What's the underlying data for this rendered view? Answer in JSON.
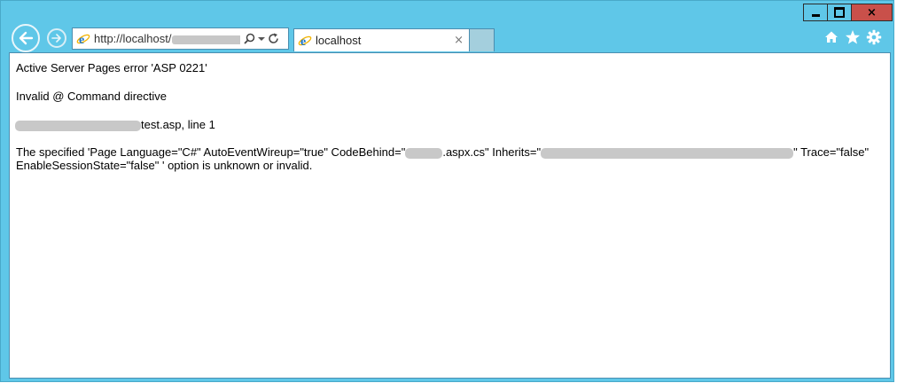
{
  "browser": {
    "address_prefix": "http://localhost/",
    "tab_title": "localhost",
    "tab_close": "×",
    "caption": {
      "minimize": "minimize",
      "maximize": "maximize",
      "close": "×"
    }
  },
  "icons": {
    "back": "back-arrow-icon",
    "forward": "forward-arrow-icon",
    "search": "search-icon",
    "dropdown": "chevron-down-icon",
    "refresh": "refresh-icon",
    "home": "home-icon",
    "favorites": "star-icon",
    "tools": "gear-icon",
    "brand": "ie-logo-icon"
  },
  "page": {
    "error_title": "Active Server Pages error 'ASP 0221'",
    "error_type": "Invalid @ Command directive",
    "location_suffix": "test.asp, line 1",
    "detail_part1": "The specified 'Page Language=\"C#\" AutoEventWireup=\"true\" CodeBehind=\"",
    "detail_part2": ".aspx.cs\" Inherits=\"",
    "detail_part3": "\" Trace=\"false\"",
    "detail_line2": "EnableSessionState=\"false\" ' option is unknown or invalid."
  },
  "colors": {
    "frame": "#5fc7e8",
    "close_button": "#c9504a",
    "redaction": "#c8c8c8"
  }
}
